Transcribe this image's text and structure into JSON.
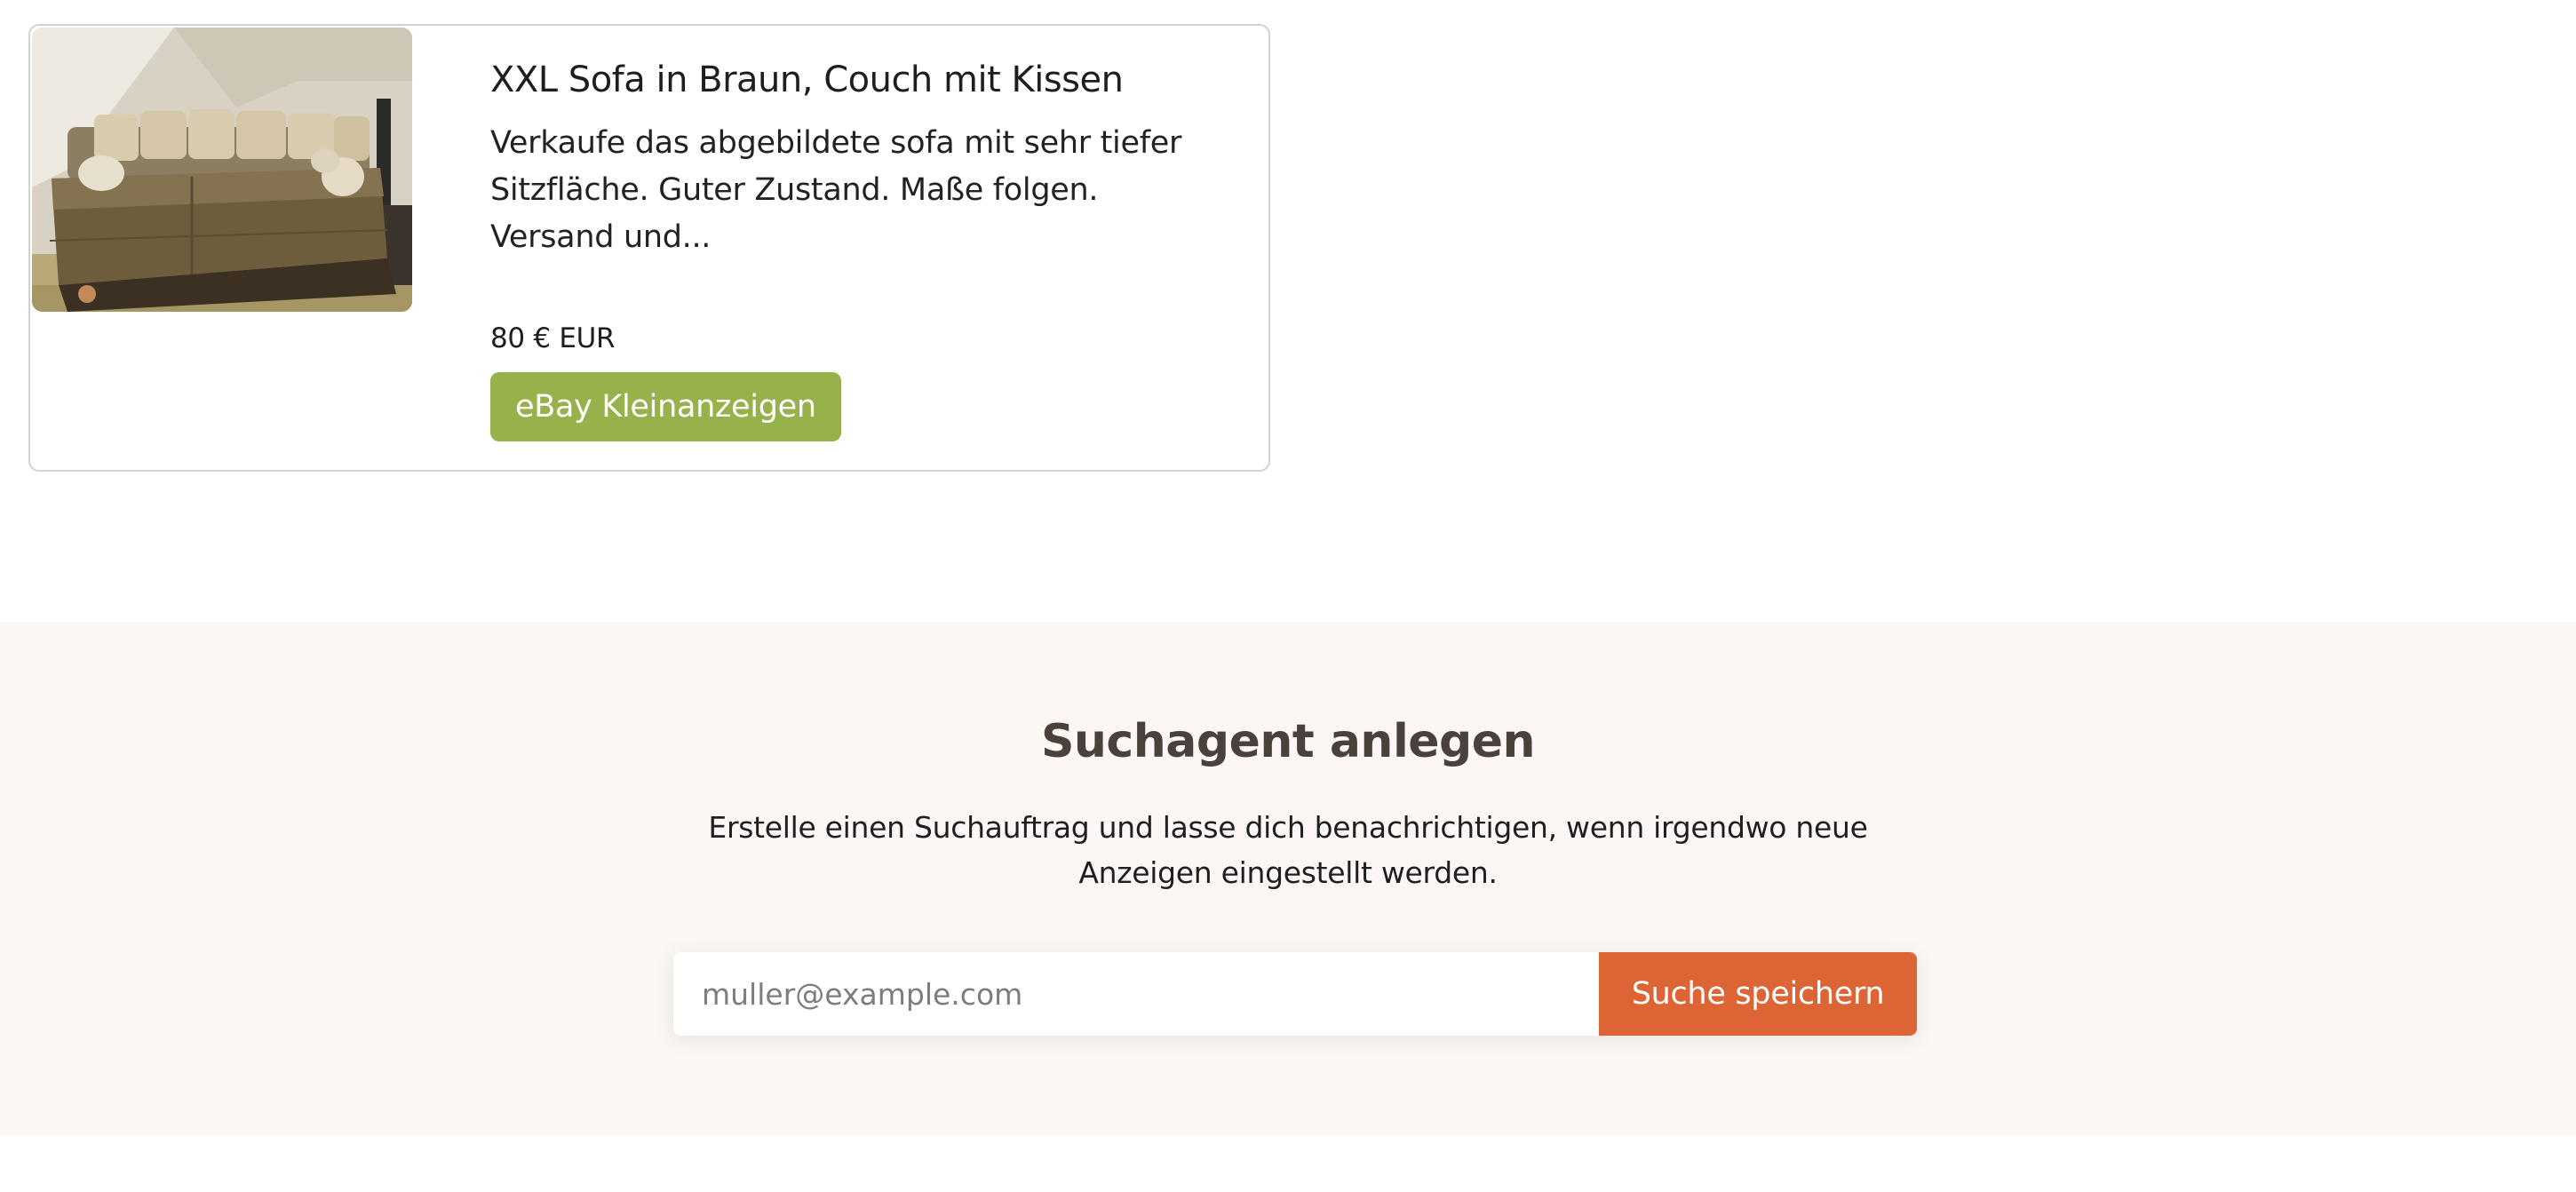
{
  "listing": {
    "title": "XXL Sofa in Braun, Couch mit Kissen",
    "description": "Verkaufe das abgebildete sofa mit sehr tiefer Sitzfläche. Guter Zustand. Maße folgen. Versand und...",
    "price": "80 € EUR",
    "source_button_label": "eBay Kleinanzeigen",
    "image_subject": "sofa-photo",
    "source_button_color": "#97b24a"
  },
  "search_agent": {
    "title": "Suchagent anlegen",
    "description": "Erstelle einen Suchauftrag und lasse dich benachrichtigen, wenn irgendwo neue Anzeigen eingestellt werden.",
    "email_placeholder": "muller@example.com",
    "email_value": "",
    "save_button_label": "Suche speichern",
    "section_background": "#fcf7f4",
    "save_button_color": "#dd6535"
  }
}
